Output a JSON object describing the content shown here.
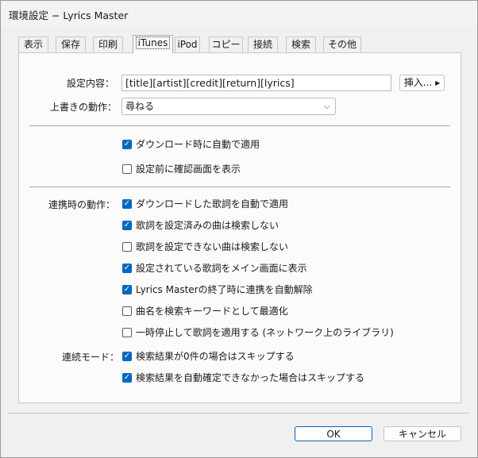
{
  "window": {
    "title": "環境設定 − Lyrics Master"
  },
  "tabs": [
    {
      "label": "表示"
    },
    {
      "label": "保存"
    },
    {
      "label": "印刷"
    },
    {
      "label": "iTunes"
    },
    {
      "label": "iPod"
    },
    {
      "label": "コピー"
    },
    {
      "label": "接続"
    },
    {
      "label": "検索"
    },
    {
      "label": "その他"
    }
  ],
  "active_tab": "iTunes",
  "settings": {
    "content_label": "設定内容：",
    "content_value": "[title][artist][credit][return][lyrics]",
    "insert_button": "挿入...",
    "overwrite_label": "上書きの動作：",
    "overwrite_value": "尋ねる"
  },
  "general_checks": [
    {
      "label": "ダウンロード時に自動で適用",
      "checked": true
    },
    {
      "label": "設定前に確認画面を表示",
      "checked": false
    }
  ],
  "link_section": {
    "label": "連携時の動作：",
    "checks": [
      {
        "label": "ダウンロードした歌詞を自動で適用",
        "checked": true
      },
      {
        "label": "歌詞を設定済みの曲は検索しない",
        "checked": true
      },
      {
        "label": "歌詞を設定できない曲は検索しない",
        "checked": false
      },
      {
        "label": "設定されている歌詞をメイン画面に表示",
        "checked": true
      },
      {
        "label": "Lyrics Masterの終了時に連携を自動解除",
        "checked": true
      },
      {
        "label": "曲名を検索キーワードとして最適化",
        "checked": false
      },
      {
        "label": "一時停止して歌詞を適用する (ネットワーク上のライブラリ)",
        "checked": false
      }
    ]
  },
  "continuous_section": {
    "label": "連続モード：",
    "checks": [
      {
        "label": "検索結果が0件の場合はスキップする",
        "checked": true
      },
      {
        "label": "検索結果を自動確定できなかった場合はスキップする",
        "checked": true
      }
    ]
  },
  "footer": {
    "ok": "OK",
    "cancel": "キャンセル"
  }
}
